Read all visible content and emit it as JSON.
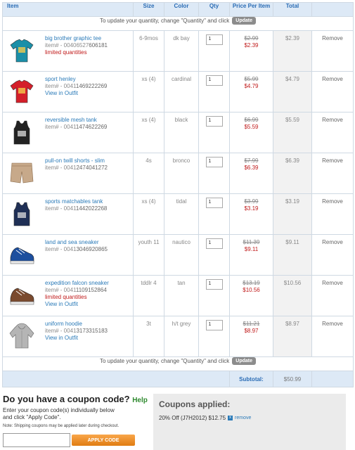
{
  "table": {
    "headers": {
      "item": "Item",
      "size": "Size",
      "color": "Color",
      "qty": "Qty",
      "price": "Price Per Item",
      "total": "Total"
    },
    "notice_text": "To update your quantity, change \"Quantity\" and click",
    "update_label": "Update",
    "remove_label": "Remove",
    "subtotal_label": "Subtotal:",
    "subtotal_value": "$50.99",
    "items": [
      {
        "name": "big brother graphic tee",
        "num_prefix": "item# - 00406527",
        "num_suffix": "606181",
        "flag": "limited quantities",
        "link": "",
        "size": "6-9mos",
        "color": "dk bay",
        "qty": "1",
        "was": "$2.99",
        "now": "$2.39",
        "total": "$2.39",
        "thumb_icon": "tshirt-icon",
        "thumb_color": "#1b8fa8"
      },
      {
        "name": "sport henley",
        "num_prefix": "item# - 0041",
        "num_suffix": "1469222269",
        "flag": "",
        "link": "View in Outfit",
        "size": "xs (4)",
        "color": "cardinal",
        "qty": "1",
        "was": "$5.99",
        "now": "$4.79",
        "total": "$4.79",
        "thumb_icon": "tshirt-icon",
        "thumb_color": "#d41f2a"
      },
      {
        "name": "reversible mesh tank",
        "num_prefix": "item# - 0041",
        "num_suffix": "1474622269",
        "flag": "",
        "link": "",
        "size": "xs (4)",
        "color": "black",
        "qty": "1",
        "was": "$6.99",
        "now": "$5.59",
        "total": "$5.59",
        "thumb_icon": "tank-top-icon",
        "thumb_color": "#222222"
      },
      {
        "name": "pull-on twill shorts - slim",
        "num_prefix": "item# - 0041",
        "num_suffix": "2474041272",
        "flag": "",
        "link": "",
        "size": "4s",
        "color": "bronco",
        "qty": "1",
        "was": "$7.99",
        "now": "$6.39",
        "total": "$6.39",
        "thumb_icon": "shorts-icon",
        "thumb_color": "#c7a98a"
      },
      {
        "name": "sports matchables tank",
        "num_prefix": "item# - 0041",
        "num_suffix": "1442022268",
        "flag": "",
        "link": "",
        "size": "xs (4)",
        "color": "tidal",
        "qty": "1",
        "was": "$3.99",
        "now": "$3.19",
        "total": "$3.19",
        "thumb_icon": "tank-top-icon",
        "thumb_color": "#1f2f55"
      },
      {
        "name": "land and sea sneaker",
        "num_prefix": "item# - 0041",
        "num_suffix": "3046920865",
        "flag": "",
        "link": "",
        "size": "youth 11",
        "color": "nautico",
        "qty": "1",
        "was": "$11.39",
        "now": "$9.11",
        "total": "$9.11",
        "thumb_icon": "sneaker-icon",
        "thumb_color": "#1d4f9e"
      },
      {
        "name": "expedition falcon sneaker",
        "num_prefix": "item# - 0041",
        "num_suffix": "1109152864",
        "flag": "limited quantities",
        "link": "View in Outfit",
        "size": "tddlr 4",
        "color": "tan",
        "qty": "1",
        "was": "$13.19",
        "now": "$10.56",
        "total": "$10.56",
        "thumb_icon": "sneaker-icon",
        "thumb_color": "#7a4a2e"
      },
      {
        "name": "uniform hoodie",
        "num_prefix": "item# - 0041",
        "num_suffix": "3173315183",
        "flag": "",
        "link": "View in Outfit",
        "size": "3t",
        "color": "h/t grey",
        "qty": "1",
        "was": "$11.21",
        "now": "$8.97",
        "total": "$8.97",
        "thumb_icon": "hoodie-icon",
        "thumb_color": "#b5b5b5"
      }
    ]
  },
  "coupon": {
    "title": "Do you have a coupon code?",
    "help": "Help",
    "desc_line1": "Enter your coupon code(s) individually below",
    "desc_line2": "and click \"Apply Code\".",
    "note": "Note: Shipping coupons may be applied later during checkout.",
    "input_value": "",
    "apply_label": "APPLY CODE"
  },
  "applied": {
    "title": "Coupons applied:",
    "line": "20% Off (J7H2012) $12.75",
    "remove_label": "remove"
  }
}
